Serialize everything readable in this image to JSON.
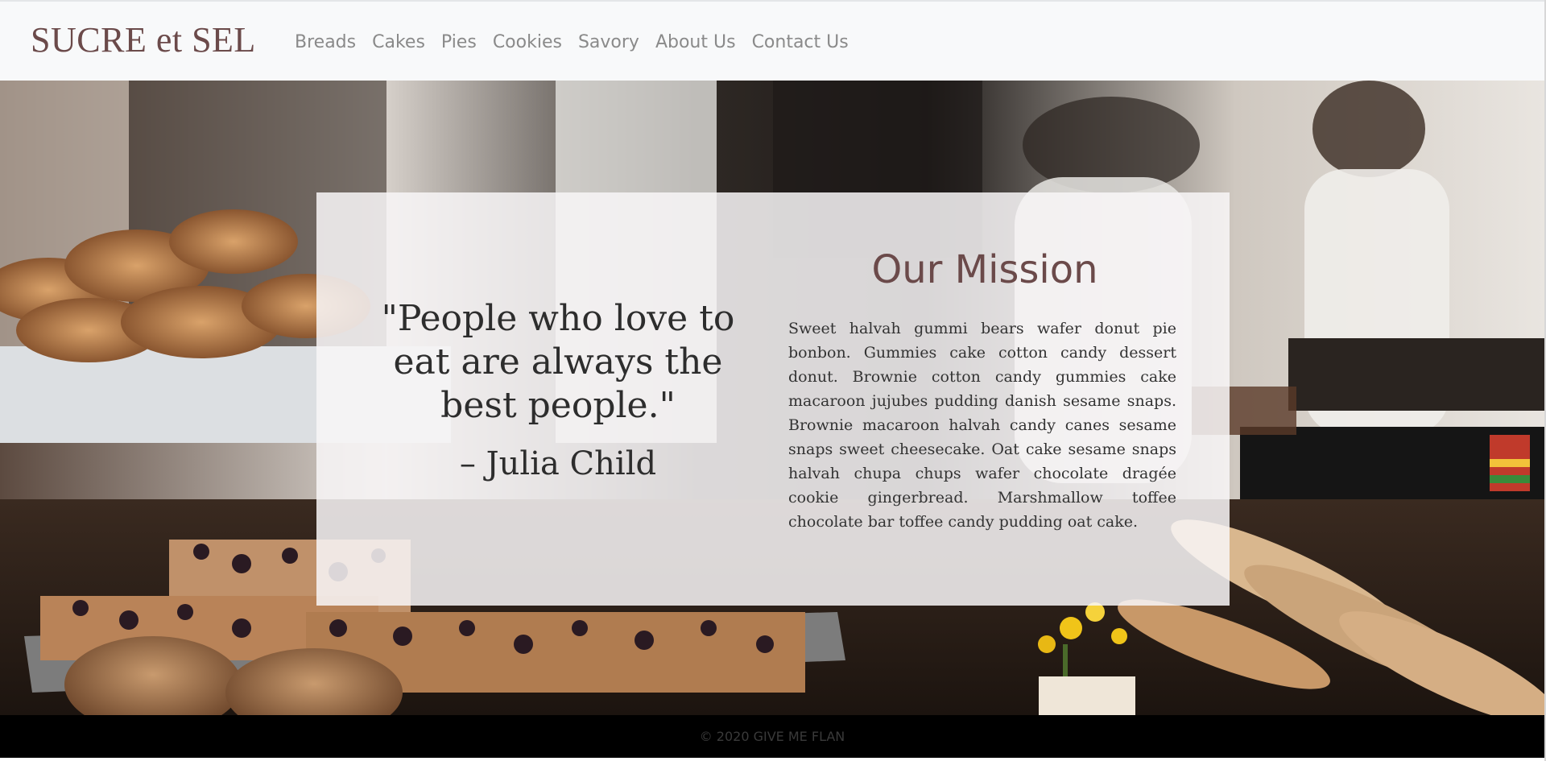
{
  "brand": {
    "name": "SUCRE et SEL",
    "color": "#6b4a4a"
  },
  "nav": {
    "items": [
      "Breads",
      "Cakes",
      "Pies",
      "Cookies",
      "Savory",
      "About Us",
      "Contact Us"
    ]
  },
  "hero": {
    "image": "bakery-display-photo",
    "quote": "\"People who love to eat are always the best people.\"",
    "author": "– Julia Child",
    "mission_title": "Our Mission",
    "mission_text": "Sweet halvah gummi bears wafer donut pie bonbon. Gummies cake cotton candy dessert donut. Brownie cotton candy gummies cake macaroon jujubes pudding danish sesame snaps. Brownie macaroon halvah candy canes sesame snaps sweet cheesecake. Oat cake sesame snaps halvah chupa chups wafer chocolate dragée cookie gingerbread. Marshmallow toffee chocolate bar toffee candy pudding oat cake."
  },
  "footer": {
    "text": "© 2020 GIVE ME FLAN"
  },
  "colors": {
    "navbar_bg": "#f8f9fa",
    "nav_link": "#8a8a8a",
    "accent": "#6b4a4a",
    "footer_bg": "#000000"
  }
}
